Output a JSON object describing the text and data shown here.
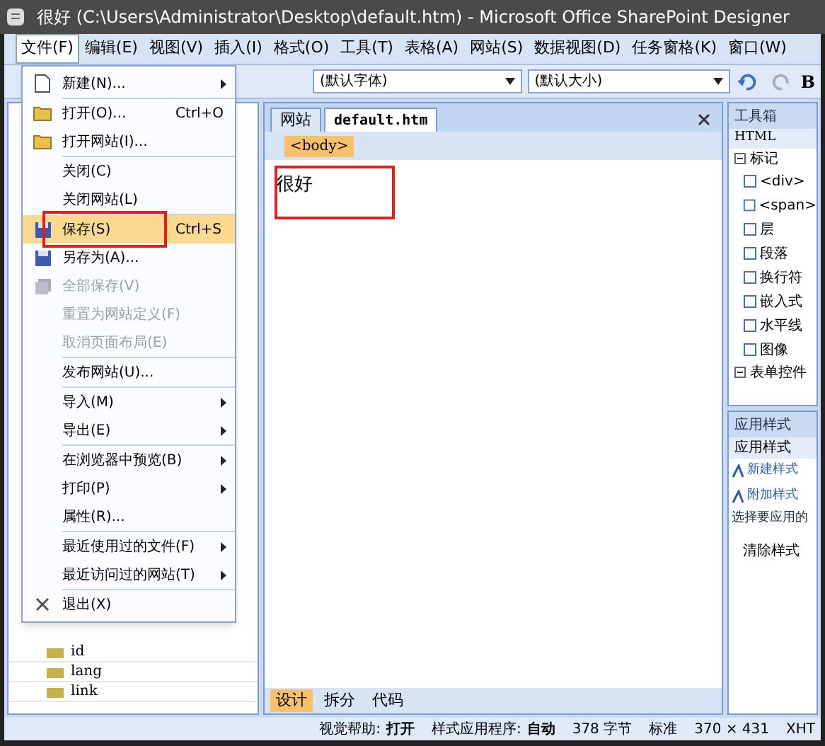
{
  "window": {
    "title": "很好 (C:\\Users\\Administrator\\Desktop\\default.htm) - Microsoft Office SharePoint Designer"
  },
  "menubar": [
    {
      "label": "文件(F)",
      "selected": true
    },
    {
      "label": "编辑(E)",
      "selected": false
    },
    {
      "label": "视图(V)",
      "selected": false
    },
    {
      "label": "插入(I)",
      "selected": false
    },
    {
      "label": "格式(O)",
      "selected": false
    },
    {
      "label": "工具(T)",
      "selected": false
    },
    {
      "label": "表格(A)",
      "selected": false
    },
    {
      "label": "网站(S)",
      "selected": false
    },
    {
      "label": "数据视图(D)",
      "selected": false
    },
    {
      "label": "任务窗格(K)",
      "selected": false
    },
    {
      "label": "窗口(W)",
      "selected": false
    }
  ],
  "toolbar": {
    "font": "(默认字体)",
    "size": "(默认大小)",
    "bold": "B"
  },
  "file_menu": [
    [
      {
        "label": "新建(N)...",
        "kind": "page",
        "submenu": true,
        "disabled": false,
        "selected": false
      }
    ],
    [
      {
        "label": "打开(O)...",
        "shortcut": "Ctrl+O",
        "kind": "folder",
        "submenu": false,
        "disabled": false,
        "selected": false
      },
      {
        "label": "打开网站(I)...",
        "kind": "folder",
        "submenu": false,
        "disabled": false,
        "selected": false
      }
    ],
    [
      {
        "label": "关闭(C)",
        "submenu": false,
        "disabled": false,
        "selected": false
      },
      {
        "label": "关闭网站(L)",
        "submenu": false,
        "disabled": false,
        "selected": false
      }
    ],
    [
      {
        "label": "保存(S)",
        "shortcut": "Ctrl+S",
        "kind": "disk",
        "submenu": false,
        "disabled": false,
        "selected": true
      },
      {
        "label": "另存为(A)...",
        "kind": "disk",
        "submenu": false,
        "disabled": false,
        "selected": false
      },
      {
        "label": "全部保存(V)",
        "kind": "disks",
        "submenu": false,
        "disabled": true,
        "selected": false
      },
      {
        "label": "重置为网站定义(F)",
        "submenu": false,
        "disabled": true,
        "selected": false
      },
      {
        "label": "取消页面布局(E)",
        "submenu": false,
        "disabled": true,
        "selected": false
      }
    ],
    [
      {
        "label": "发布网站(U)...",
        "submenu": false,
        "disabled": false,
        "selected": false
      }
    ],
    [
      {
        "label": "导入(M)",
        "submenu": true,
        "disabled": false,
        "selected": false
      },
      {
        "label": "导出(E)",
        "submenu": true,
        "disabled": false,
        "selected": false
      }
    ],
    [
      {
        "label": "在浏览器中预览(B)",
        "submenu": true,
        "disabled": false,
        "selected": false
      },
      {
        "label": "打印(P)",
        "submenu": true,
        "disabled": false,
        "selected": false
      },
      {
        "label": "属性(R)...",
        "submenu": false,
        "disabled": false,
        "selected": false
      }
    ],
    [
      {
        "label": "最近使用过的文件(F)",
        "submenu": true,
        "disabled": false,
        "selected": false
      },
      {
        "label": "最近访问过的网站(T)",
        "submenu": true,
        "disabled": false,
        "selected": false
      }
    ],
    [
      {
        "label": "退出(X)",
        "kind": "exit",
        "submenu": false,
        "disabled": false,
        "selected": false
      }
    ]
  ],
  "attributes": [
    "id",
    "lang",
    "link"
  ],
  "editor": {
    "tabs": [
      {
        "label": "网站",
        "selected": false
      },
      {
        "label": "default.htm",
        "selected": true
      }
    ],
    "breadcrumb": "<body>",
    "content": "很好",
    "view_tabs": [
      {
        "label": "设计",
        "selected": true
      },
      {
        "label": "拆分",
        "selected": false
      },
      {
        "label": "代码",
        "selected": false
      }
    ]
  },
  "toolbox": {
    "title": "工具箱",
    "group": "HTML",
    "section": "标记",
    "items": [
      "<div>",
      "<span>",
      "层",
      "段落",
      "换行符",
      "嵌入式",
      "水平线",
      "图像"
    ],
    "section_2": "表单控件"
  },
  "styles": {
    "title": "应用样式",
    "tab": "应用样式",
    "actions": [
      "新建样式",
      "附加样式"
    ],
    "prompt": "选择要应用的",
    "clear": "清除样式"
  },
  "status_bar": [
    {
      "label": "视觉帮助:",
      "value": "打开"
    },
    {
      "label": "样式应用程序:",
      "value": "自动"
    },
    {
      "label": "378 字节"
    },
    {
      "label": "标准"
    },
    {
      "label": "370 × 431"
    },
    {
      "label": "XHT"
    }
  ]
}
